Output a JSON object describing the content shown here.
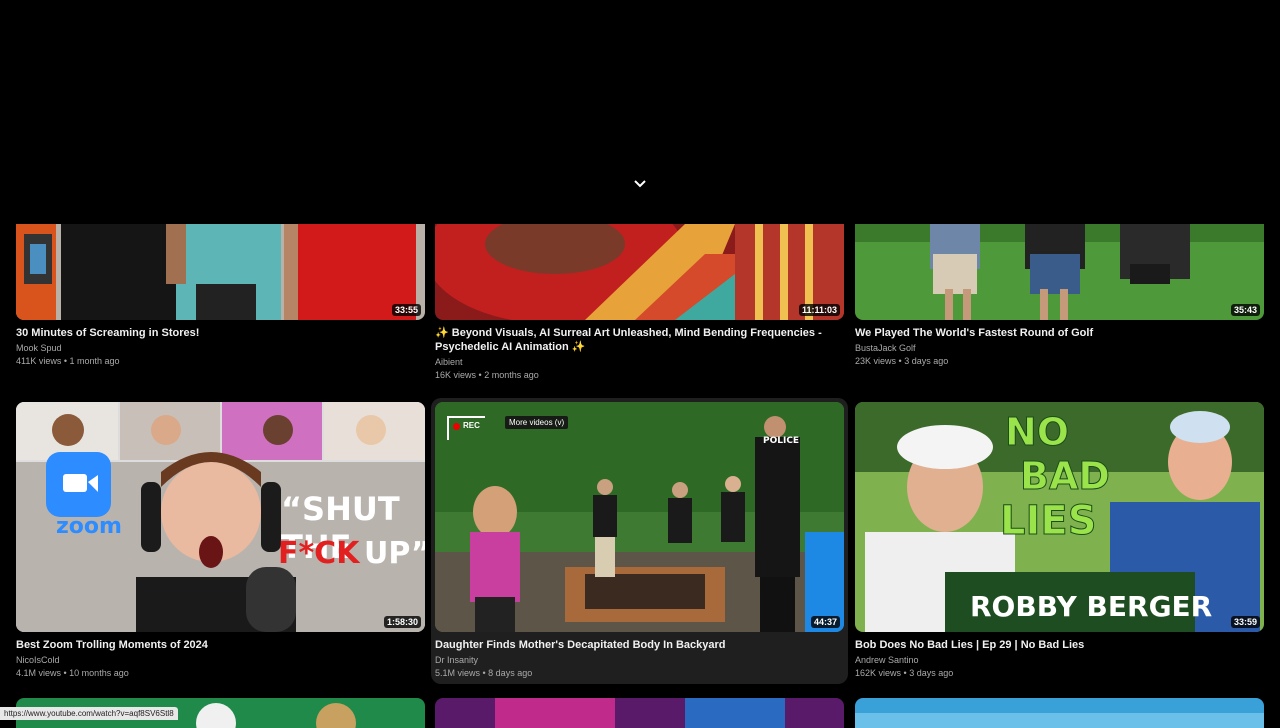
{
  "chevron_icon": "chevron-down-icon",
  "videos": [
    {
      "title": "30 Minutes of Screaming in Stores!",
      "channel": "Mook Spud",
      "views": "411K views",
      "age": "1 month ago",
      "duration": "33:55"
    },
    {
      "title": "✨ Beyond Visuals, AI Surreal Art Unleashed, Mind Bending Frequencies - Psychedelic AI Animation ✨",
      "channel": "Aibient",
      "views": "16K views",
      "age": "2 months ago",
      "duration": "11:11:03"
    },
    {
      "title": "We Played The World's Fastest Round of Golf",
      "channel": "BustaJack Golf",
      "views": "23K views",
      "age": "3 days ago",
      "duration": "35:43"
    },
    {
      "title": "Best Zoom Trolling Moments of 2024",
      "channel": "NicoIsCold",
      "views": "4.1M views",
      "age": "10 months ago",
      "duration": "1:58:30",
      "thumb_text": [
        "“SHUT THE",
        "F*CK",
        "UP”"
      ],
      "zoom_label": "zoom"
    },
    {
      "title": "Daughter Finds Mother's Decapitated Body In Backyard",
      "channel": "Dr Insanity",
      "views": "5.1M views",
      "age": "8 days ago",
      "duration": "44:37",
      "tooltip": "More videos (v)",
      "rec_label": "REC",
      "police_label": "POLICE"
    },
    {
      "title": "Bob Does No Bad Lies | Ep 29 | No Bad Lies",
      "channel": "Andrew Santino",
      "views": "162K views",
      "age": "3 days ago",
      "duration": "33:59",
      "thumb_text": [
        "NO",
        "BAD",
        "LIES",
        "ROBBY BERGER"
      ]
    }
  ],
  "status_url": "https://www.youtube.com/watch?v=aqf8SV6Stl8",
  "colors": {
    "background": "#000000",
    "meta": "#aaaaaa"
  }
}
